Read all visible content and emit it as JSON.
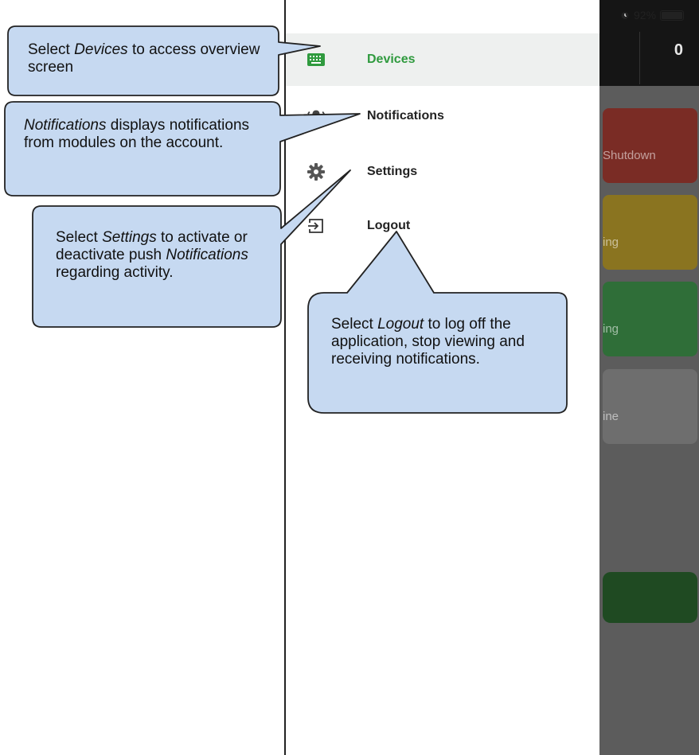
{
  "status_bar": {
    "battery_percent": "92%"
  },
  "background_app": {
    "counter": "0",
    "tiles": [
      "Shutdown",
      "ing",
      "ing",
      "ine"
    ]
  },
  "drawer": {
    "items": [
      {
        "label": "Devices",
        "icon": "keyboard-icon",
        "active": true
      },
      {
        "label": "Notifications",
        "icon": "bell-ringing-icon",
        "active": false
      },
      {
        "label": "Settings",
        "icon": "gear-icon",
        "active": false
      },
      {
        "label": "Logout",
        "icon": "logout-icon",
        "active": false
      }
    ]
  },
  "callouts": {
    "devices": {
      "pre": "Select ",
      "em": "Devices",
      "post": " to access overview screen"
    },
    "notifications": {
      "em": "Notifications",
      "post": " displays notifications from modules on the account."
    },
    "settings": {
      "pre": "Select ",
      "em": "Settings",
      "mid": " to activate or deactivate push ",
      "em2": "Notifications",
      "post": " regarding activity."
    },
    "logout": {
      "pre": "Select ",
      "em": "Logout",
      "post": " to log off the application, stop viewing and receiving notifications."
    }
  },
  "colors": {
    "accent_green": "#2f9a3e",
    "callout_fill": "#c6d9f1",
    "tile_red": "#7a2c25",
    "tile_yellow": "#8a7420",
    "tile_green": "#2f6e38"
  }
}
